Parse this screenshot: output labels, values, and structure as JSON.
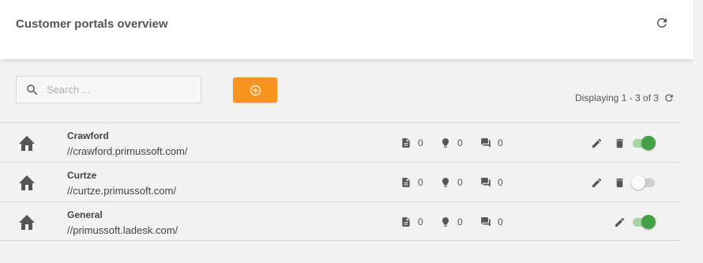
{
  "header": {
    "title": "Customer portals overview",
    "refresh_icon": "refresh-icon"
  },
  "search": {
    "placeholder": "Search ...",
    "value": ""
  },
  "add_button": {
    "icon": "plus-circle-icon",
    "color": "#f7941d"
  },
  "paging": {
    "text": "Displaying 1 - 3 of 3"
  },
  "colors": {
    "accent": "#f7941d",
    "toggle_on": "#43a047",
    "toggle_on_track": "#a5d6a7"
  },
  "portals": [
    {
      "name": "Crawford",
      "url": "//crawford.primussoft.com/",
      "docs": "0",
      "ideas": "0",
      "messages": "0",
      "editable": true,
      "deletable": true,
      "enabled": true
    },
    {
      "name": "Curtze",
      "url": "//curtze.primussoft.com/",
      "docs": "0",
      "ideas": "0",
      "messages": "0",
      "editable": true,
      "deletable": true,
      "enabled": false
    },
    {
      "name": "General",
      "url": "//primussoft.ladesk.com/",
      "docs": "0",
      "ideas": "0",
      "messages": "0",
      "editable": true,
      "deletable": false,
      "enabled": true
    }
  ]
}
